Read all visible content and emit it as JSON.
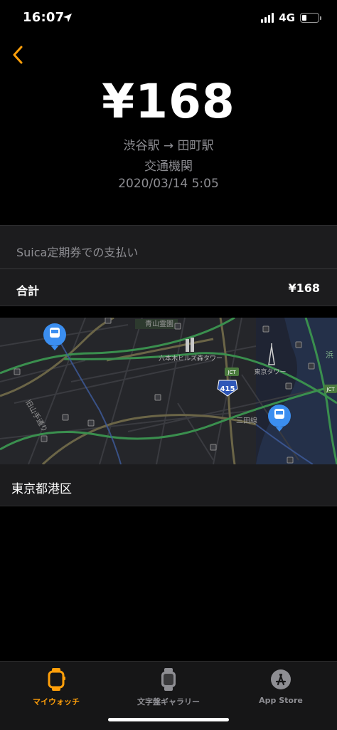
{
  "status_bar": {
    "time": "16:07",
    "network": "4G",
    "battery_level": 0.3
  },
  "transaction": {
    "amount": "¥168",
    "route": "渋谷駅 → 田町駅",
    "category": "交通機関",
    "datetime": "2020/03/14 5:05"
  },
  "payment": {
    "method": "Suica定期券での支払い",
    "total_label": "合計",
    "total_value": "¥168"
  },
  "map": {
    "labels": {
      "aoyama": "青山霊園",
      "roppongi": "六本木ヒルズ森タワー",
      "tokyo_tower": "東京タワー",
      "kyuyamate": "旧山手通り",
      "mita": "三田線",
      "route_415": "415",
      "jct1": "JCT",
      "jct2": "JCT",
      "hama": "浜"
    },
    "area_name": "東京都港区"
  },
  "tab_bar": {
    "tabs": [
      {
        "label": "マイウォッチ",
        "icon": "watch-icon",
        "active": true
      },
      {
        "label": "文字盤ギャラリー",
        "icon": "watch-face-icon",
        "active": false
      },
      {
        "label": "App Store",
        "icon": "app-store-icon",
        "active": false
      }
    ]
  },
  "colors": {
    "accent": "#ff9f0a",
    "transit_pin": "#3b8ef0",
    "secondary_text": "#8e8e93"
  }
}
